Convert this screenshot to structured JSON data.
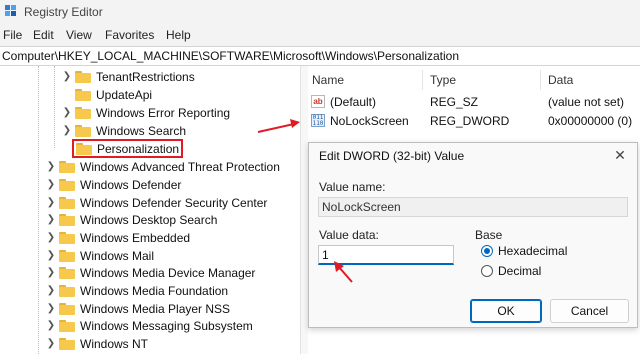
{
  "window": {
    "title": "Registry Editor"
  },
  "menu": [
    "File",
    "Edit",
    "View",
    "Favorites",
    "Help"
  ],
  "address": "Computer\\HKEY_LOCAL_MACHINE\\SOFTWARE\\Microsoft\\Windows\\Personalization",
  "tree": {
    "children": [
      "TenantRestrictions",
      "UpdateApi",
      "Windows Error Reporting",
      "Windows Search",
      "Personalization"
    ],
    "siblings": [
      "Windows Advanced Threat Protection",
      "Windows Defender",
      "Windows Defender Security Center",
      "Windows Desktop Search",
      "Windows Embedded",
      "Windows Mail",
      "Windows Media Device Manager",
      "Windows Media Foundation",
      "Windows Media Player NSS",
      "Windows Messaging Subsystem",
      "Windows NT"
    ]
  },
  "list": {
    "columns": [
      "Name",
      "Type",
      "Data"
    ],
    "rows": [
      {
        "icon": "string-value-icon",
        "name": "(Default)",
        "type": "REG_SZ",
        "data": "(value not set)"
      },
      {
        "icon": "binary-value-icon",
        "name": "NoLockScreen",
        "type": "REG_DWORD",
        "data": "0x00000000 (0)"
      }
    ]
  },
  "dialog": {
    "title": "Edit DWORD (32-bit) Value",
    "value_name_label": "Value name:",
    "value_name": "NoLockScreen",
    "value_data_label": "Value data:",
    "value_data": "1",
    "base_label": "Base",
    "base_options": [
      "Hexadecimal",
      "Decimal"
    ],
    "base_selected": "Hexadecimal",
    "ok_label": "OK",
    "cancel_label": "Cancel"
  },
  "colors": {
    "highlight": "#e01b24",
    "accent": "#0067c0",
    "folder": "#f6c94c"
  }
}
